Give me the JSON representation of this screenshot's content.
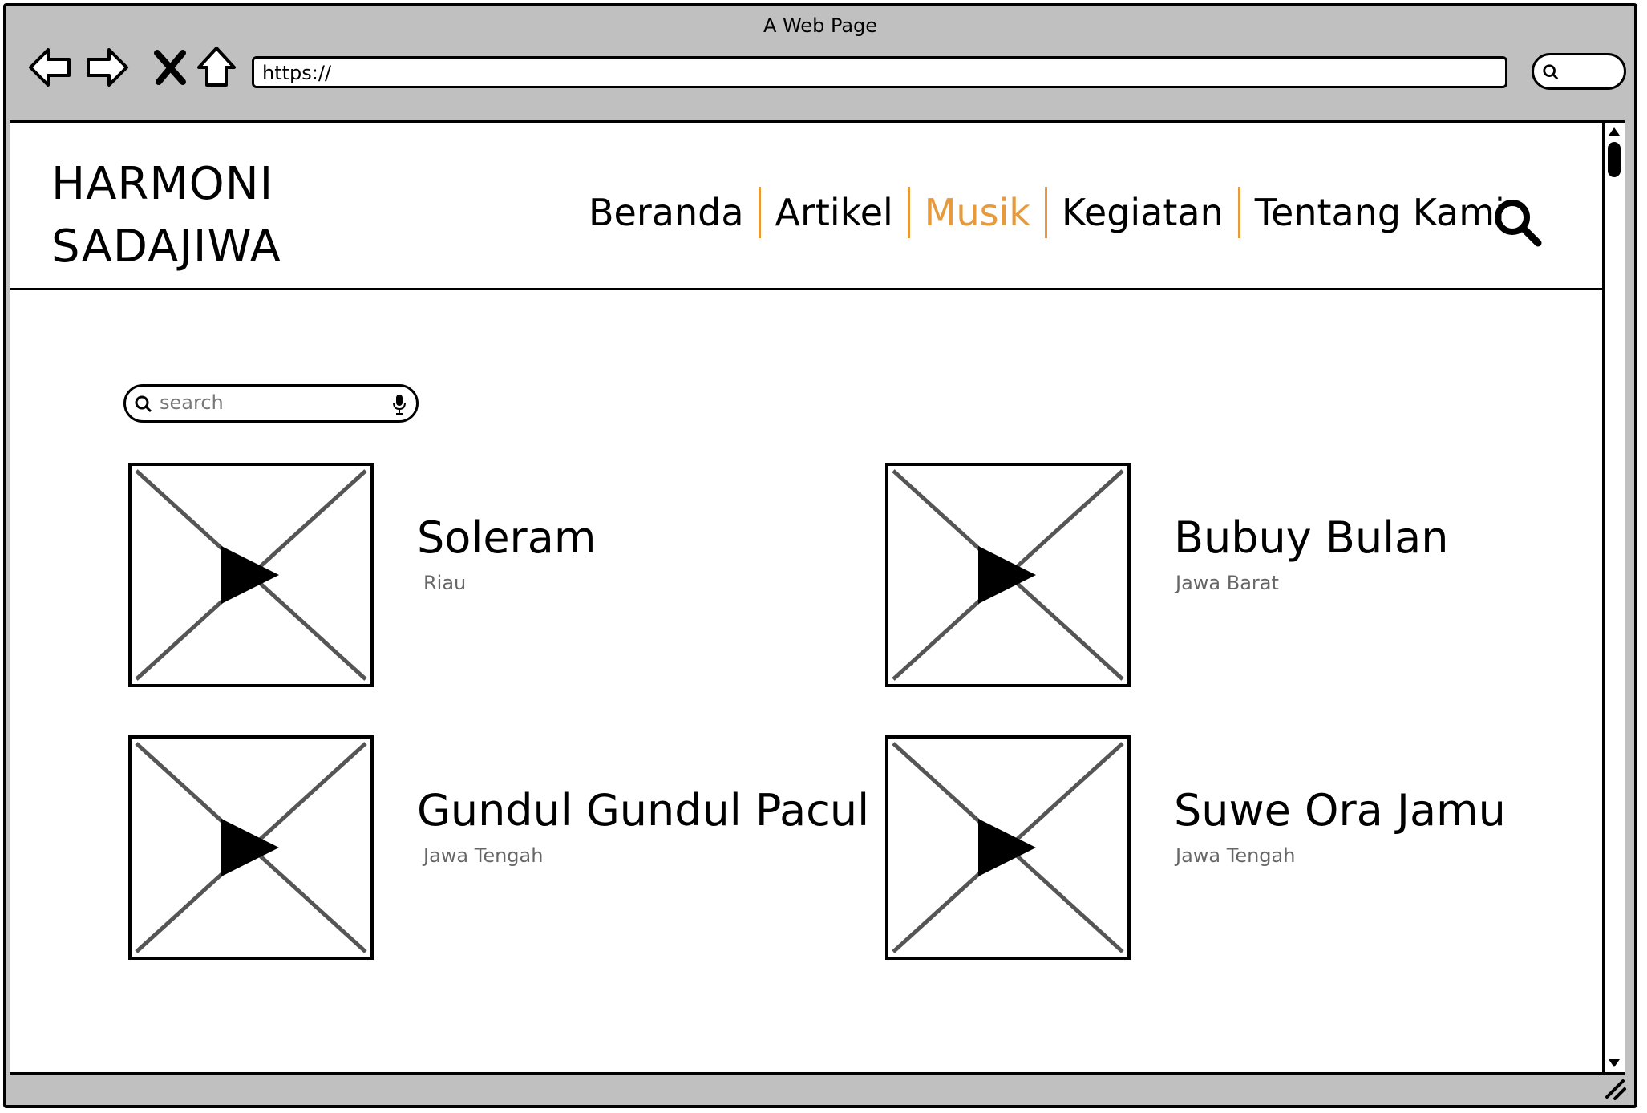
{
  "browser": {
    "title": "A Web Page",
    "url": "https://"
  },
  "site": {
    "logo_line1": "HARMONI",
    "logo_line2": "SADAJIWA"
  },
  "nav": {
    "items": [
      {
        "label": "Beranda"
      },
      {
        "label": "Artikel"
      },
      {
        "label": "Musik",
        "active": true
      },
      {
        "label": "Kegiatan"
      },
      {
        "label": "Tentang Kami"
      }
    ]
  },
  "search": {
    "placeholder": "search"
  },
  "songs": [
    {
      "title": "Soleram",
      "region": "Riau"
    },
    {
      "title": "Bubuy Bulan",
      "region": "Jawa Barat"
    },
    {
      "title": "Gundul Gundul Pacul",
      "region": "Jawa Tengah"
    },
    {
      "title": "Suwe Ora Jamu",
      "region": "Jawa Tengah"
    }
  ],
  "colors": {
    "accent": "#e69a3c",
    "chrome": "#c0c0c0"
  }
}
